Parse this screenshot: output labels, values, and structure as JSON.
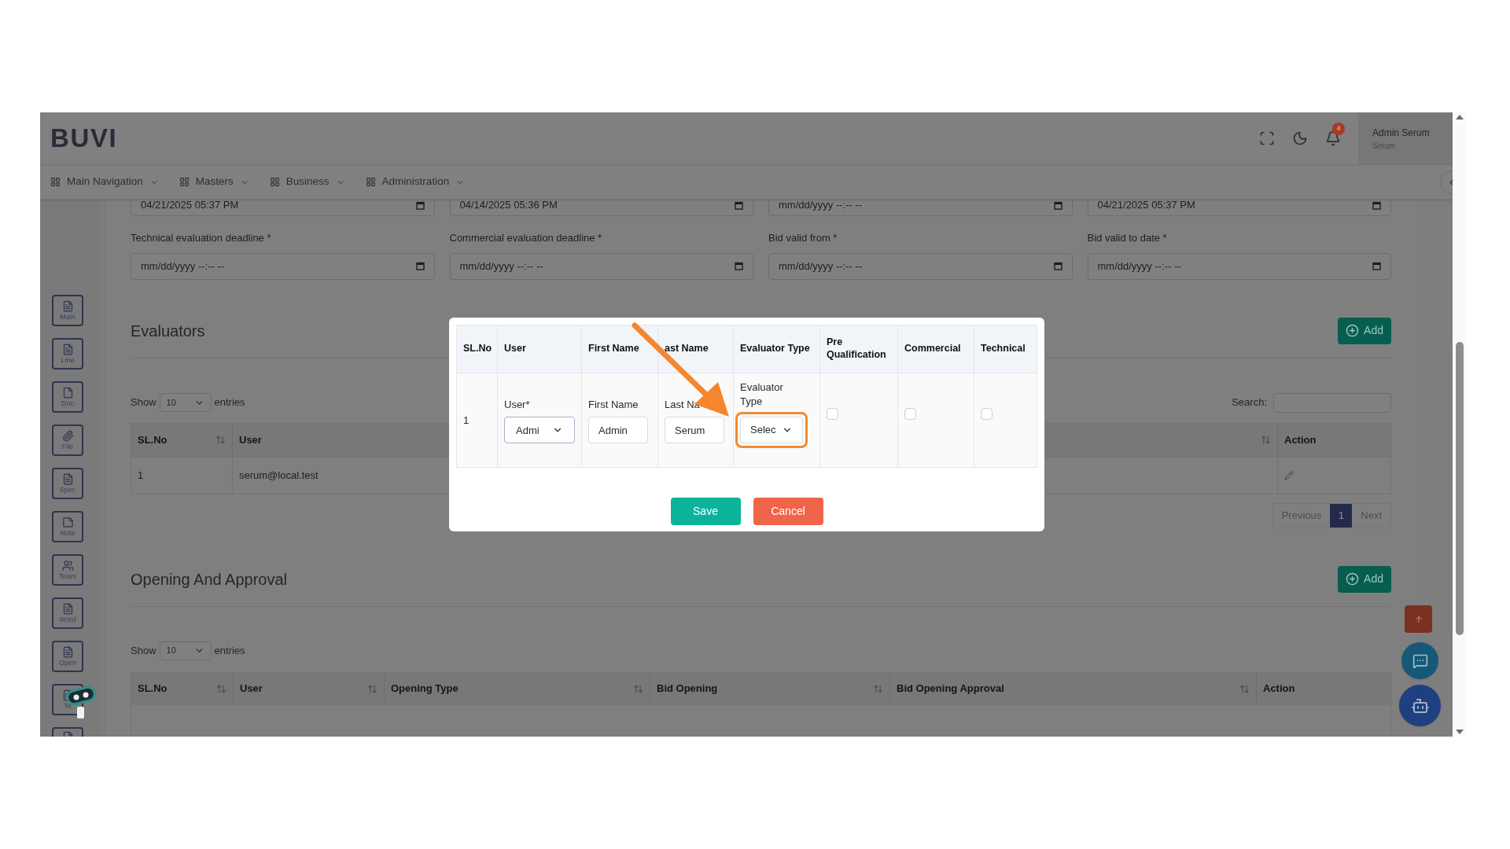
{
  "header": {
    "logo": "BUVI",
    "notification_count": "4",
    "user_name": "Admin Serum",
    "user_role": "Serum"
  },
  "nav": [
    {
      "label": "Main Navigation"
    },
    {
      "label": "Masters"
    },
    {
      "label": "Business"
    },
    {
      "label": "Administration"
    }
  ],
  "sidebar": [
    {
      "label": "Main",
      "kind": "list"
    },
    {
      "label": "Line",
      "kind": "list"
    },
    {
      "label": "Doc",
      "kind": "page"
    },
    {
      "label": "File",
      "kind": "clip"
    },
    {
      "label": "Spec",
      "kind": "list"
    },
    {
      "label": "Note",
      "kind": "note"
    },
    {
      "label": "Team",
      "kind": "team"
    },
    {
      "label": "Word",
      "kind": "list"
    },
    {
      "label": "Open",
      "kind": "list"
    },
    {
      "label": "Te",
      "kind": "list"
    },
    {
      "kind": "page"
    }
  ],
  "top_dates": [
    {
      "value": "04/21/2025 05:37 PM"
    },
    {
      "value": "04/14/2025 05:36 PM"
    },
    {
      "value": "mm/dd/yyyy --:-- --"
    },
    {
      "value": "04/21/2025 05:37 PM"
    }
  ],
  "date_fields": [
    {
      "label": "Technical evaluation deadline *",
      "value": "mm/dd/yyyy --:-- --"
    },
    {
      "label": "Commercial evaluation deadline *",
      "value": "mm/dd/yyyy --:-- --"
    },
    {
      "label": "Bid valid from *",
      "value": "mm/dd/yyyy --:-- --"
    },
    {
      "label": "Bid valid to date *",
      "value": "mm/dd/yyyy --:-- --"
    }
  ],
  "evaluators": {
    "title": "Evaluators",
    "add_button": "Add",
    "show": "Show",
    "page_size": "10",
    "entries": "entries",
    "search_label": "Search:",
    "columns": [
      "SL.No",
      "User",
      "Action"
    ],
    "rows": [
      {
        "sl_no": "1",
        "user": "serum@local.test"
      }
    ],
    "pagination": {
      "previous": "Previous",
      "pages": [
        {
          "label": "1",
          "selected": true
        }
      ],
      "next": "Next"
    }
  },
  "opening": {
    "title": "Opening And Approval",
    "add_button": "Add",
    "show": "Show",
    "page_size": "10",
    "entries": "entries",
    "columns": [
      "SL.No",
      "User",
      "Opening Type",
      "Bid Opening",
      "Bid Opening Approval",
      "Action"
    ]
  },
  "modal": {
    "columns": [
      "SL.No",
      "User",
      "First Name",
      "ast Name",
      "Evaluator Type",
      "Pre Qualification",
      "Commercial",
      "Technical"
    ],
    "row": {
      "sl_no": "1",
      "user_label": "User*",
      "user_value": "Admi",
      "first_label": "First Name",
      "first_value": "Admin",
      "last_label": "Last Na",
      "last_value": "Serum",
      "type_label": "Evaluator Type",
      "type_value": "Selec",
      "checks": [
        {
          "checked": false
        },
        {
          "checked": false
        },
        {
          "checked": false
        }
      ]
    },
    "save": "Save",
    "cancel": "Cancel"
  }
}
